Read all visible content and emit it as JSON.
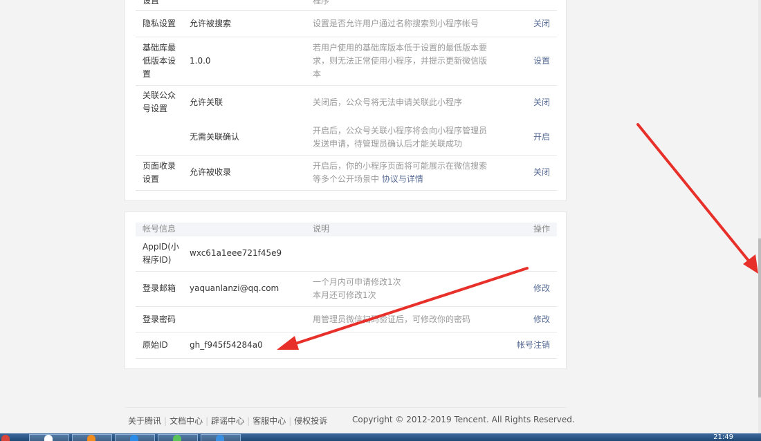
{
  "settings_rows": [
    {
      "name": "设置",
      "value": "",
      "desc": "程序",
      "action": ""
    },
    {
      "name": "隐私设置",
      "value": "允许被搜索",
      "desc": "设置是否允许用户通过名称搜索到小程序帐号",
      "action": "关闭"
    },
    {
      "name": "基础库最低版本设置",
      "value": "1.0.0",
      "desc": "若用户使用的基础库版本低于设置的最低版本要求，则无法正常使用小程序，并提示更新微信版本",
      "action": "设置"
    },
    {
      "name": "关联公众号设置",
      "value": "允许关联",
      "desc": "关闭后，公众号将无法申请关联此小程序",
      "action": "关闭"
    },
    {
      "name": "",
      "value": "无需关联确认",
      "desc": "开启后，公众号关联小程序将会向小程序管理员发送申请，待管理员确认后才能关联成功",
      "action": "开启"
    },
    {
      "name": "页面收录设置",
      "value": "允许被收录",
      "desc": "开启后，你的小程序页面将可能展示在微信搜索等多个公开场景中",
      "desc_link": "协议与详情",
      "action": "关闭"
    }
  ],
  "account_table": {
    "headers": {
      "name": "帐号信息",
      "desc": "说明",
      "action": "操作"
    },
    "rows": [
      {
        "name": "AppID(小程序ID)",
        "value": "wxc61a1eee721f45e9",
        "desc": "",
        "action": ""
      },
      {
        "name": "登录邮箱",
        "value": "yaquanlanzi@qq.com",
        "desc_line1": "一个月内可申请修改1次",
        "desc_line2": "本月还可修改1次",
        "action": "修改"
      },
      {
        "name": "登录密码",
        "value": "",
        "desc": "用管理员微信扫码验证后，可修改你的密码",
        "action": "修改"
      },
      {
        "name": "原始ID",
        "value": "gh_f945f54284a0",
        "desc": "",
        "action": "帐号注销"
      }
    ]
  },
  "footer": {
    "links": [
      "关于腾讯",
      "文档中心",
      "辟谣中心",
      "客服中心",
      "侵权投诉"
    ],
    "copyright": "Copyright © 2012-2019 Tencent. All Rights Reserved."
  },
  "taskbar": {
    "clock": "21:49"
  },
  "colors": {
    "link": "#576b95",
    "annotation_arrow": "#e8302a",
    "muted": "#9a9a9a"
  }
}
